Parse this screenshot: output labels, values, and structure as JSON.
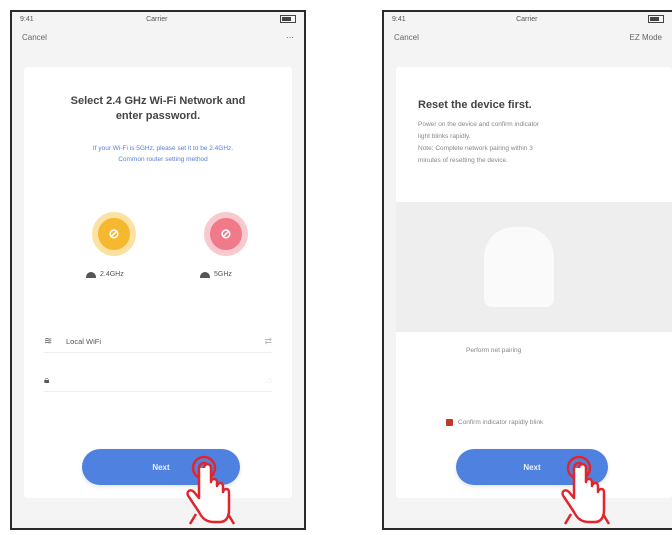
{
  "left_screen": {
    "status_time": "9:41",
    "status_carrier": "Carrier",
    "nav_back": "Cancel",
    "title_line1": "Select 2.4 GHz Wi-Fi Network and",
    "title_line2": "enter password.",
    "note_line1": "If your Wi-Fi is 5GHz, please set it to be 2.4GHz.",
    "note_line2": "Common router setting method",
    "router_24_glyph": "⊘",
    "router_24_label": "2.4GHz",
    "router_5_glyph": "⊘",
    "router_5_label": "5GHz",
    "wifi_row_text": "Local WiFi",
    "password_row_text": "",
    "next_label": "Next"
  },
  "right_screen": {
    "status_time": "9:41",
    "status_carrier": "Carrier",
    "nav_back": "Cancel",
    "nav_right": "EZ Mode",
    "title": "Reset the device first.",
    "step_line1": "Power on the device and confirm indicator",
    "step_line2": "light blinks rapidly.",
    "step_line3": "Note: Complete network pairing within 3",
    "step_line4": "minutes of resetting the device.",
    "illustration_caption": "Perform net pairing",
    "checkbox_text": "Confirm indicator rapidly blink",
    "next_label": "Next"
  },
  "colors": {
    "accent_blue": "#4f82e0",
    "router_24": "#f5b82e",
    "router_5": "#f07a8a",
    "hand": "#e0262b"
  },
  "icons": {
    "wifi": "wifi-icon",
    "lock": "lock-icon",
    "hand": "tap-hand-icon"
  }
}
